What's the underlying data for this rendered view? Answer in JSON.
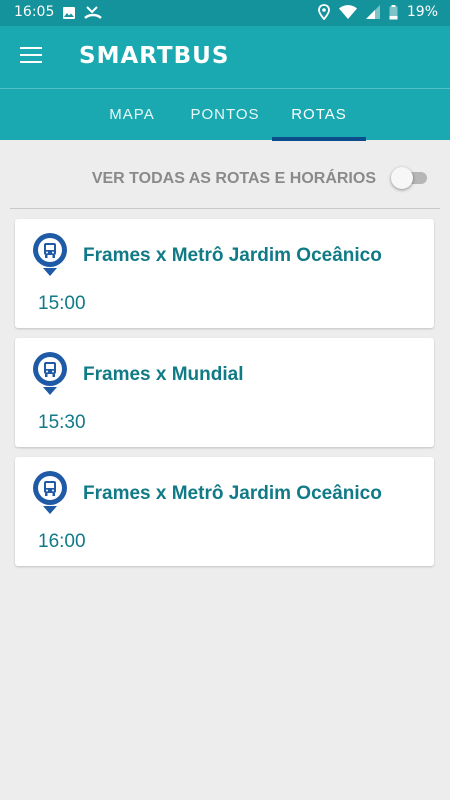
{
  "status_bar": {
    "time": "16:05",
    "battery_percent": "19%",
    "icons": [
      "image-icon",
      "missed-call-icon",
      "location-icon",
      "wifi-icon",
      "cell-signal-icon",
      "battery-icon"
    ]
  },
  "app_bar": {
    "title": "SMARTBUS",
    "menu_icon": "hamburger-menu-icon"
  },
  "tabs": [
    {
      "label": "MAPA",
      "active": false
    },
    {
      "label": "PONTOS",
      "active": false
    },
    {
      "label": "ROTAS",
      "active": true
    }
  ],
  "toggle": {
    "label": "VER TODAS AS ROTAS E HORÁRIOS",
    "on": false
  },
  "routes": [
    {
      "name": "Frames x Metrô Jardim Oceânico",
      "time": "15:00",
      "icon": "bus-stop-pin-icon"
    },
    {
      "name": "Frames x Mundial",
      "time": "15:30",
      "icon": "bus-stop-pin-icon"
    },
    {
      "name": "Frames x Metrô Jardim Oceânico",
      "time": "16:00",
      "icon": "bus-stop-pin-icon"
    }
  ],
  "colors": {
    "status_bar": "#15939c",
    "app_bar": "#1aa9b1",
    "tab_indicator": "#0c4e8c",
    "route_text": "#107a86",
    "pin_blue": "#1f5aa6",
    "background": "#ededed"
  }
}
